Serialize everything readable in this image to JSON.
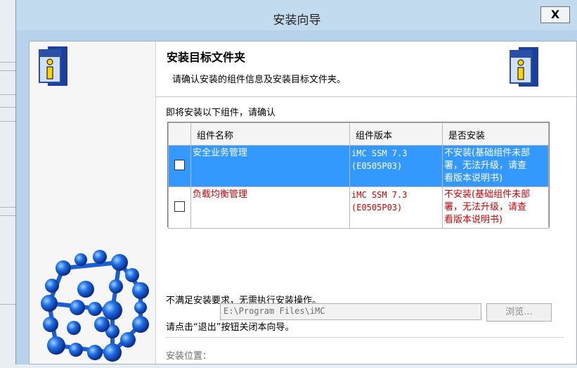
{
  "window": {
    "title": "安装向导",
    "close_label": "X"
  },
  "header": {
    "title": "安装目标文件夹",
    "subtitle": "请确认安装的组件信息及安装目标文件夹。"
  },
  "body": {
    "prompt": "即将安装以下组件，请确认",
    "message_1": "不满足安装要求，无需执行安装操作。",
    "message_2": "请点击“退出”按钮关闭本向导。"
  },
  "table": {
    "columns": [
      "组件名称",
      "组件版本",
      "是否安装"
    ],
    "rows": [
      {
        "name": "安全业务管理",
        "version_line1": "iMC SSM 7.3",
        "version_line2": "(E0505P03)",
        "status_lines": [
          "不安装(基础组件未部",
          "署，无法升级，请查",
          "看版本说明书)"
        ],
        "checked": false,
        "selected": true
      },
      {
        "name": "负载均衡管理",
        "version_line1": "iMC SSM 7.3",
        "version_line2": "(E0505P03)",
        "status_lines": [
          "不安装(基础组件未部",
          "署，无法升级，请查",
          "看版本说明书)"
        ],
        "checked": false,
        "selected": false
      }
    ]
  },
  "location": {
    "label": "安装位置：",
    "value": "E:\\Program Files\\iMC",
    "browse_label": "浏览..."
  },
  "icons": {
    "wizard_icon": "info-book-icon",
    "header_icon": "info-book-icon",
    "decoration": "molecule-cube-graphic"
  },
  "colors": {
    "selection": "#3399ff",
    "warning_text": "#d10000",
    "titlebar": "#c3dbef"
  }
}
